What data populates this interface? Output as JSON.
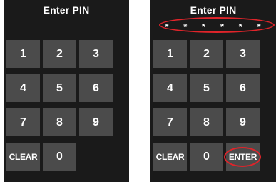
{
  "left_screen": {
    "title": "Enter PIN",
    "keys": {
      "k1": "1",
      "k2": "2",
      "k3": "3",
      "k4": "4",
      "k5": "5",
      "k6": "6",
      "k7": "7",
      "k8": "8",
      "k9": "9",
      "clear": "CLEAR",
      "k0": "0"
    }
  },
  "right_screen": {
    "title": "Enter PIN",
    "pin_mask": [
      "*",
      "*",
      "*",
      "*",
      "*",
      "*"
    ],
    "keys": {
      "k1": "1",
      "k2": "2",
      "k3": "3",
      "k4": "4",
      "k5": "5",
      "k6": "6",
      "k7": "7",
      "k8": "8",
      "k9": "9",
      "clear": "CLEAR",
      "k0": "0",
      "enter": "ENTER"
    }
  },
  "colors": {
    "screen_bg": "#1a1a1a",
    "key_bg": "#4b4b4b",
    "highlight": "#e0242a"
  }
}
